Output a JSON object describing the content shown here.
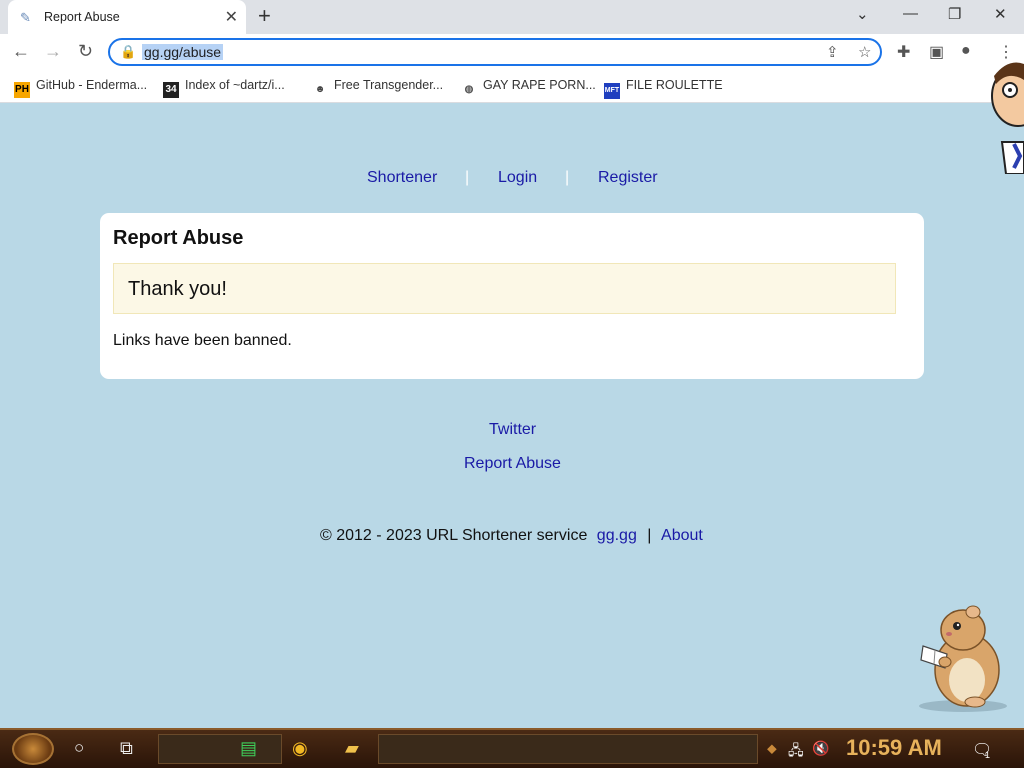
{
  "browser": {
    "tab_title": "Report Abuse",
    "url": "gg.gg/abuse",
    "bookmarks": [
      {
        "label": "GitHub - Enderma...",
        "icon": "PH"
      },
      {
        "label": "Index of ~dartz/i...",
        "icon": "34"
      },
      {
        "label": "Free Transgender...",
        "icon": "mask"
      },
      {
        "label": "GAY RAPE PORN...",
        "icon": "globe"
      },
      {
        "label": "FILE ROULETTE",
        "icon": "MFT"
      }
    ]
  },
  "page": {
    "nav": {
      "shortener": "Shortener",
      "login": "Login",
      "register": "Register",
      "separator": "|"
    },
    "card": {
      "title": "Report Abuse",
      "alert": "Thank you!",
      "message": "Links have been banned."
    },
    "footer": {
      "twitter": "Twitter",
      "report_abuse": "Report Abuse",
      "copyright": "© 2012 - 2023 URL Shortener service",
      "site_link": "gg.gg",
      "separator": "|",
      "about": "About"
    }
  },
  "taskbar": {
    "clock": "10:59 AM",
    "notification_count": "1"
  },
  "colors": {
    "page_background": "#b9d8e6",
    "link": "#1a1aa6",
    "alert_background": "#fcf8e6"
  }
}
